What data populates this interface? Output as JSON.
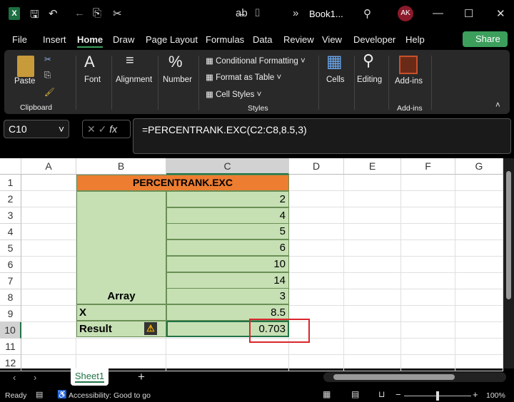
{
  "title_bar": {
    "title": "Book1...",
    "avatar": "AK"
  },
  "menu": [
    "File",
    "Insert",
    "Home",
    "Draw",
    "Page Layout",
    "Formulas",
    "Data",
    "Review",
    "View",
    "Developer",
    "Help"
  ],
  "share_label": "Share",
  "ribbon": {
    "paste": "Paste",
    "clipboard": "Clipboard",
    "font": "Font",
    "alignment": "Alignment",
    "number": "Number",
    "conditional_formatting": "Conditional Formatting",
    "format_as_table": "Format as Table",
    "cell_styles": "Cell Styles",
    "styles": "Styles",
    "cells": "Cells",
    "editing": "Editing",
    "addins": "Add-ins",
    "addins_group": "Add-ins"
  },
  "name_box": "C10",
  "formula": "=PERCENTRANK.EXC(C2:C8,8.5,3)",
  "columns": [
    "A",
    "B",
    "C",
    "D",
    "E",
    "F",
    "G"
  ],
  "rows": [
    "1",
    "2",
    "3",
    "4",
    "5",
    "6",
    "7",
    "8",
    "9",
    "10",
    "11",
    "12"
  ],
  "table": {
    "header": "PERCENTRANK.EXC",
    "array_label": "Array",
    "array_values": [
      "2",
      "4",
      "5",
      "6",
      "10",
      "14",
      "3"
    ],
    "x_label": "X",
    "x_value": "8.5",
    "result_label": "Result",
    "result_value": "0.703"
  },
  "colors": {
    "header_orange": "#ed7d31",
    "cell_green": "#c6e0b4",
    "highlight_red": "#d9262c",
    "share_green": "#3c9f5c"
  },
  "sheet_tab": "Sheet1",
  "status": {
    "ready": "Ready",
    "accessibility": "Accessibility: Good to go",
    "zoom": "100%"
  }
}
